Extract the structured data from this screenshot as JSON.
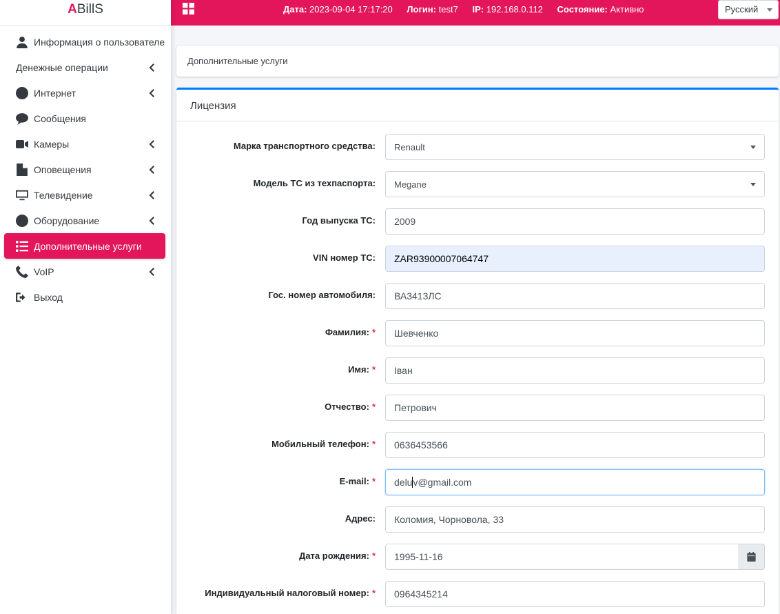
{
  "brand": {
    "first_letter": "A",
    "rest": "BillS"
  },
  "topbar": {
    "date_label": "Дата:",
    "date_value": "2023-09-04 17:17:20",
    "login_label": "Логин:",
    "login_value": "test7",
    "ip_label": "IP:",
    "ip_value": "192.168.0.112",
    "state_label": "Состояние:",
    "state_value": "Активно",
    "language": "Русский"
  },
  "sidebar": {
    "items": [
      {
        "label": "Информация о пользователе",
        "icon": "user-icon"
      },
      {
        "label": "Денежные операции",
        "icon": ""
      },
      {
        "label": "Интернет",
        "icon": "circle-icon"
      },
      {
        "label": "Сообщения",
        "icon": "comment-icon"
      },
      {
        "label": "Камеры",
        "icon": "video-icon"
      },
      {
        "label": "Оповещения",
        "icon": "file-icon"
      },
      {
        "label": "Телевидение",
        "icon": "tv-icon"
      },
      {
        "label": "Оборудование",
        "icon": "circle-icon"
      },
      {
        "label": "Дополнительные услуги",
        "icon": "list-icon"
      },
      {
        "label": "VoIP",
        "icon": "phone-icon"
      },
      {
        "label": "Выход",
        "icon": "sign-out-icon"
      }
    ]
  },
  "breadcrumb_card": {
    "title": "Дополнительные услуги"
  },
  "form": {
    "title": "Лицензия",
    "fields": {
      "brand": {
        "label": "Марка транспортного средства:",
        "value": "Renault"
      },
      "model": {
        "label": "Модель ТС из техпаспорта:",
        "value": "Megane"
      },
      "year": {
        "label": "Год выпуска ТС:",
        "value": "2009"
      },
      "vin": {
        "label": "VIN номер ТС:",
        "value": "ZAR93900007064747"
      },
      "plate": {
        "label": "Гос. номер автомобиля:",
        "value": "ВА3413ЛС"
      },
      "surname": {
        "label": "Фамилия:",
        "value": "Шевченко"
      },
      "name": {
        "label": "Имя:",
        "value": "Іван"
      },
      "patronymic": {
        "label": "Отчество:",
        "value": "Петрович"
      },
      "phone": {
        "label": "Мобильный телефон:",
        "value": "0636453566"
      },
      "email": {
        "label": "E-mail:",
        "value_before_cursor": "delu",
        "value_after_cursor": "v@gmail.com"
      },
      "address": {
        "label": "Адрес:",
        "value": "Коломия, Чорновола, 33"
      },
      "birthdate": {
        "label": "Дата рождения:",
        "value": "1995-11-16"
      },
      "tax_id": {
        "label": "Индивидуальный налоговый номер:",
        "value": "0964345214"
      }
    },
    "required_mark": "*"
  },
  "colors": {
    "accent": "#e3165b",
    "card_top": "#007bff",
    "required": "#dc3545"
  }
}
